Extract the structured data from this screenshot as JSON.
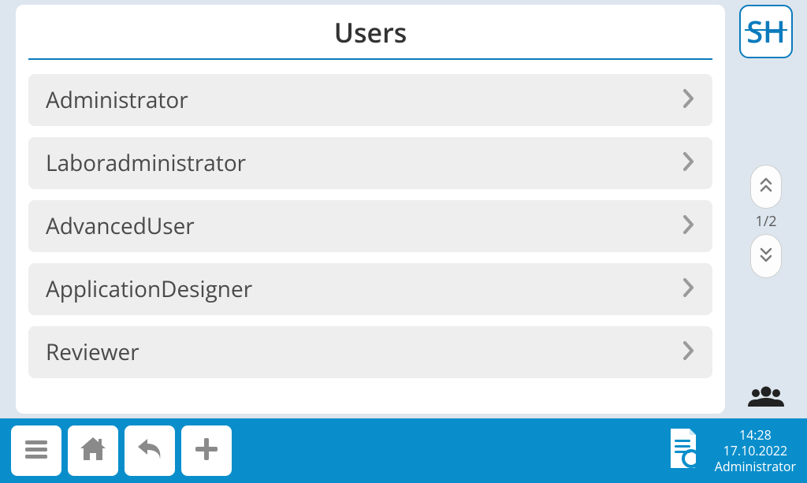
{
  "title": "Users",
  "logo_text": "SH",
  "users": [
    {
      "label": "Administrator"
    },
    {
      "label": "Laboradministrator"
    },
    {
      "label": "AdvancedUser"
    },
    {
      "label": "ApplicationDesigner"
    },
    {
      "label": "Reviewer"
    }
  ],
  "pager": {
    "label": "1/2"
  },
  "status": {
    "time": "14:28",
    "date": "17.10.2022",
    "user": "Administrator"
  }
}
